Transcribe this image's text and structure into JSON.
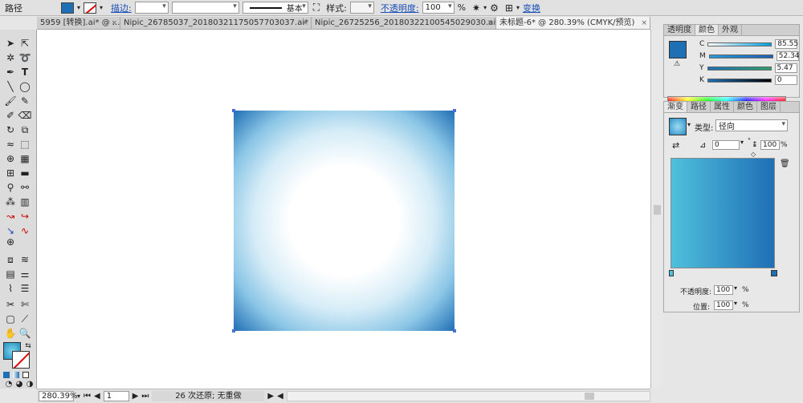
{
  "control_bar": {
    "path_label": "路径",
    "stroke_label": "描边:",
    "stroke_profile": "基本",
    "style_label": "样式:",
    "opacity_label": "不透明度:",
    "opacity_value": "100",
    "opacity_unit": "%",
    "transform_label": "变换"
  },
  "doc_tabs": [
    {
      "label": "5959 [转换].ai* @ ..."
    },
    {
      "label": "Nipic_26785037_20180321175057703037.ai*"
    },
    {
      "label": "Nipic_26725256_20180322100545029030.ai*"
    },
    {
      "label": "未标题-6* @ 280.39% (CMYK/预览)"
    }
  ],
  "color_panel": {
    "tabs": [
      "透明度",
      "颜色",
      "外观"
    ],
    "channels": [
      {
        "name": "C",
        "value": "85.55",
        "color": "#00a0e0"
      },
      {
        "name": "M",
        "value": "52.34",
        "color": "#e0007a"
      },
      {
        "name": "Y",
        "value": "5.47",
        "color": "#e8e000"
      },
      {
        "name": "K",
        "value": "0",
        "color": "#000000"
      }
    ]
  },
  "gradient_panel": {
    "tabs": [
      "渐变",
      "路径",
      "属性",
      "颜色",
      "图层"
    ],
    "type_label": "类型:",
    "type_value": "径向",
    "angle_value": "0",
    "angle_unit": "°",
    "aspect_value": "100",
    "aspect_unit": "%",
    "opacity_label": "不透明度:",
    "opacity_value": "100",
    "location_label": "位置:",
    "location_value": "100",
    "percent": "%"
  },
  "status_bar": {
    "zoom": "280.39%",
    "page": "1",
    "undo_status": "26 次还原; 无重做"
  },
  "colors": {
    "fill_blue": "#1f6fb5",
    "gradient_start": "#4fc0dc",
    "gradient_end": "#1f6fb5"
  },
  "icons": {
    "tools": [
      "selection-icon",
      "direct-selection-icon",
      "magic-wand-icon",
      "lasso-icon",
      "pen-icon",
      "type-icon",
      "line-icon",
      "ellipse-icon",
      "brush-icon",
      "pencil-icon",
      "blob-brush-icon",
      "eraser-icon",
      "rotate-icon",
      "scale-icon",
      "warp-icon",
      "free-transform-icon",
      "shape-builder-icon",
      "perspective-icon",
      "mesh-icon",
      "gradient-icon",
      "eyedropper-icon",
      "blend-icon",
      "symbol-sprayer-icon",
      "graph-icon",
      "artboard-icon",
      "slice-icon",
      "hand-icon",
      "zoom-icon"
    ]
  }
}
